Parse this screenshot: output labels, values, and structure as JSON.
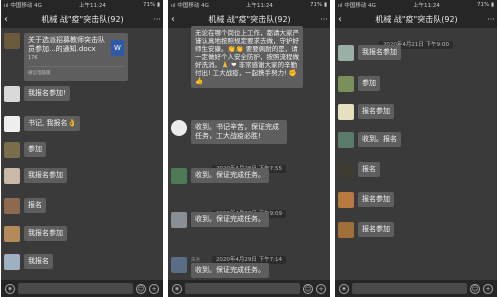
{
  "status": {
    "left": "ııl 中国移动 4G",
    "time": "上午11:24",
    "battery": "71% ▮"
  },
  "header": {
    "title": "机械 战\"疫\"突击队(92)",
    "back_icon": "‹",
    "more_icon": "···"
  },
  "panel1": {
    "file": {
      "name": "关于选派招募教师突击队员参加...的通知.docx",
      "size": "17K",
      "icon_text": "W",
      "source": "微信电脑版"
    },
    "messages": [
      "我报名参加!",
      "书记, 我报名👌",
      "参加",
      "我报名参加",
      "报名",
      "我报名参加",
      "我报名"
    ]
  },
  "panel2": {
    "notice": "无论在哪个岗位上工作，都请大家严谨认真地按照规定要求去做，守护好师生安康。👏👏 要要佩耐的是，请一定做好个人安全防护，按照流程做好洗消。🙏 ❤ 非常感谢大家的辛勤付出! 工大战疫，一起携手努力! ✊👍",
    "reply1": "收到。书记辛苦，保证完成任务，工大战疫必胜!",
    "ts1": "2020年4月28日 下午7:55",
    "reply2": "收到。保证完成任务。",
    "ts2": "2020年4月28日 下午9:09",
    "reply3": "收到。保证完成任务。",
    "ts3": "2020年4月29日 下午7:14",
    "sender": "朱洪",
    "reply4": "收到。保证完成任务。"
  },
  "panel3": {
    "ts": "2020年4月21日 下午9:00",
    "messages": [
      "我报名参加",
      "参加",
      "报名参加",
      "收到。报名",
      "报名",
      "报名参加",
      "报名参加"
    ]
  },
  "bottom": {
    "voice": "◉",
    "emoji": "☺",
    "plus": "+"
  }
}
